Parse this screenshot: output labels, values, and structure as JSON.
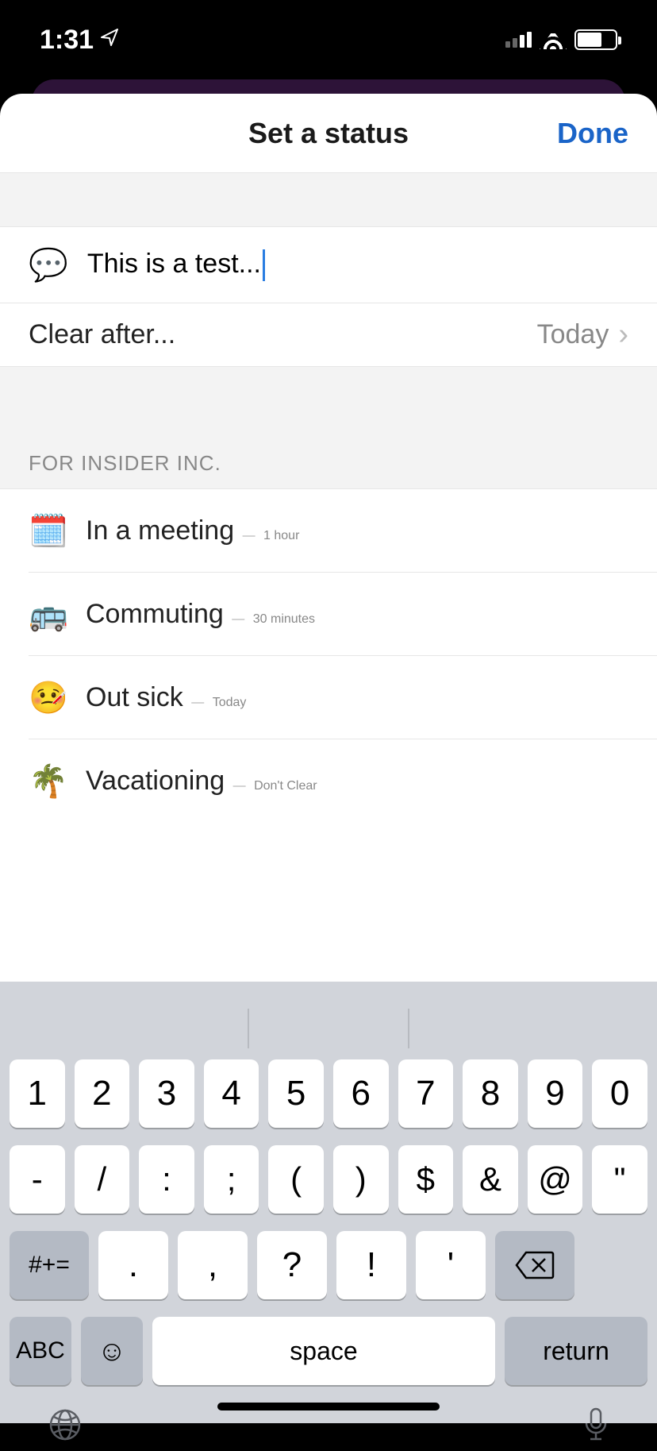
{
  "statusbar": {
    "time": "1:31"
  },
  "sheet": {
    "title": "Set a status",
    "done": "Done"
  },
  "status_input": {
    "emoji": "💬",
    "text": "This is a test..."
  },
  "clear_after": {
    "label": "Clear after...",
    "value": "Today"
  },
  "section_header": "FOR INSIDER INC.",
  "presets": [
    {
      "emoji": "🗓️",
      "label": "In a meeting",
      "duration": "1 hour"
    },
    {
      "emoji": "🚌",
      "label": "Commuting",
      "duration": "30 minutes"
    },
    {
      "emoji": "🤒",
      "label": "Out sick",
      "duration": "Today"
    },
    {
      "emoji": "🌴",
      "label": "Vacationing",
      "duration": "Don't Clear"
    }
  ],
  "keyboard": {
    "row1": [
      "1",
      "2",
      "3",
      "4",
      "5",
      "6",
      "7",
      "8",
      "9",
      "0"
    ],
    "row2": [
      "-",
      "/",
      ":",
      ";",
      "(",
      ")",
      "$",
      "&",
      "@",
      "\""
    ],
    "row3": {
      "sym": "#+=",
      "keys": [
        ".",
        ",",
        "?",
        "!",
        "'"
      ],
      "backspace": "⌫"
    },
    "row4": {
      "abc": "ABC",
      "emoji": "☺",
      "space": "space",
      "return": "return"
    }
  }
}
